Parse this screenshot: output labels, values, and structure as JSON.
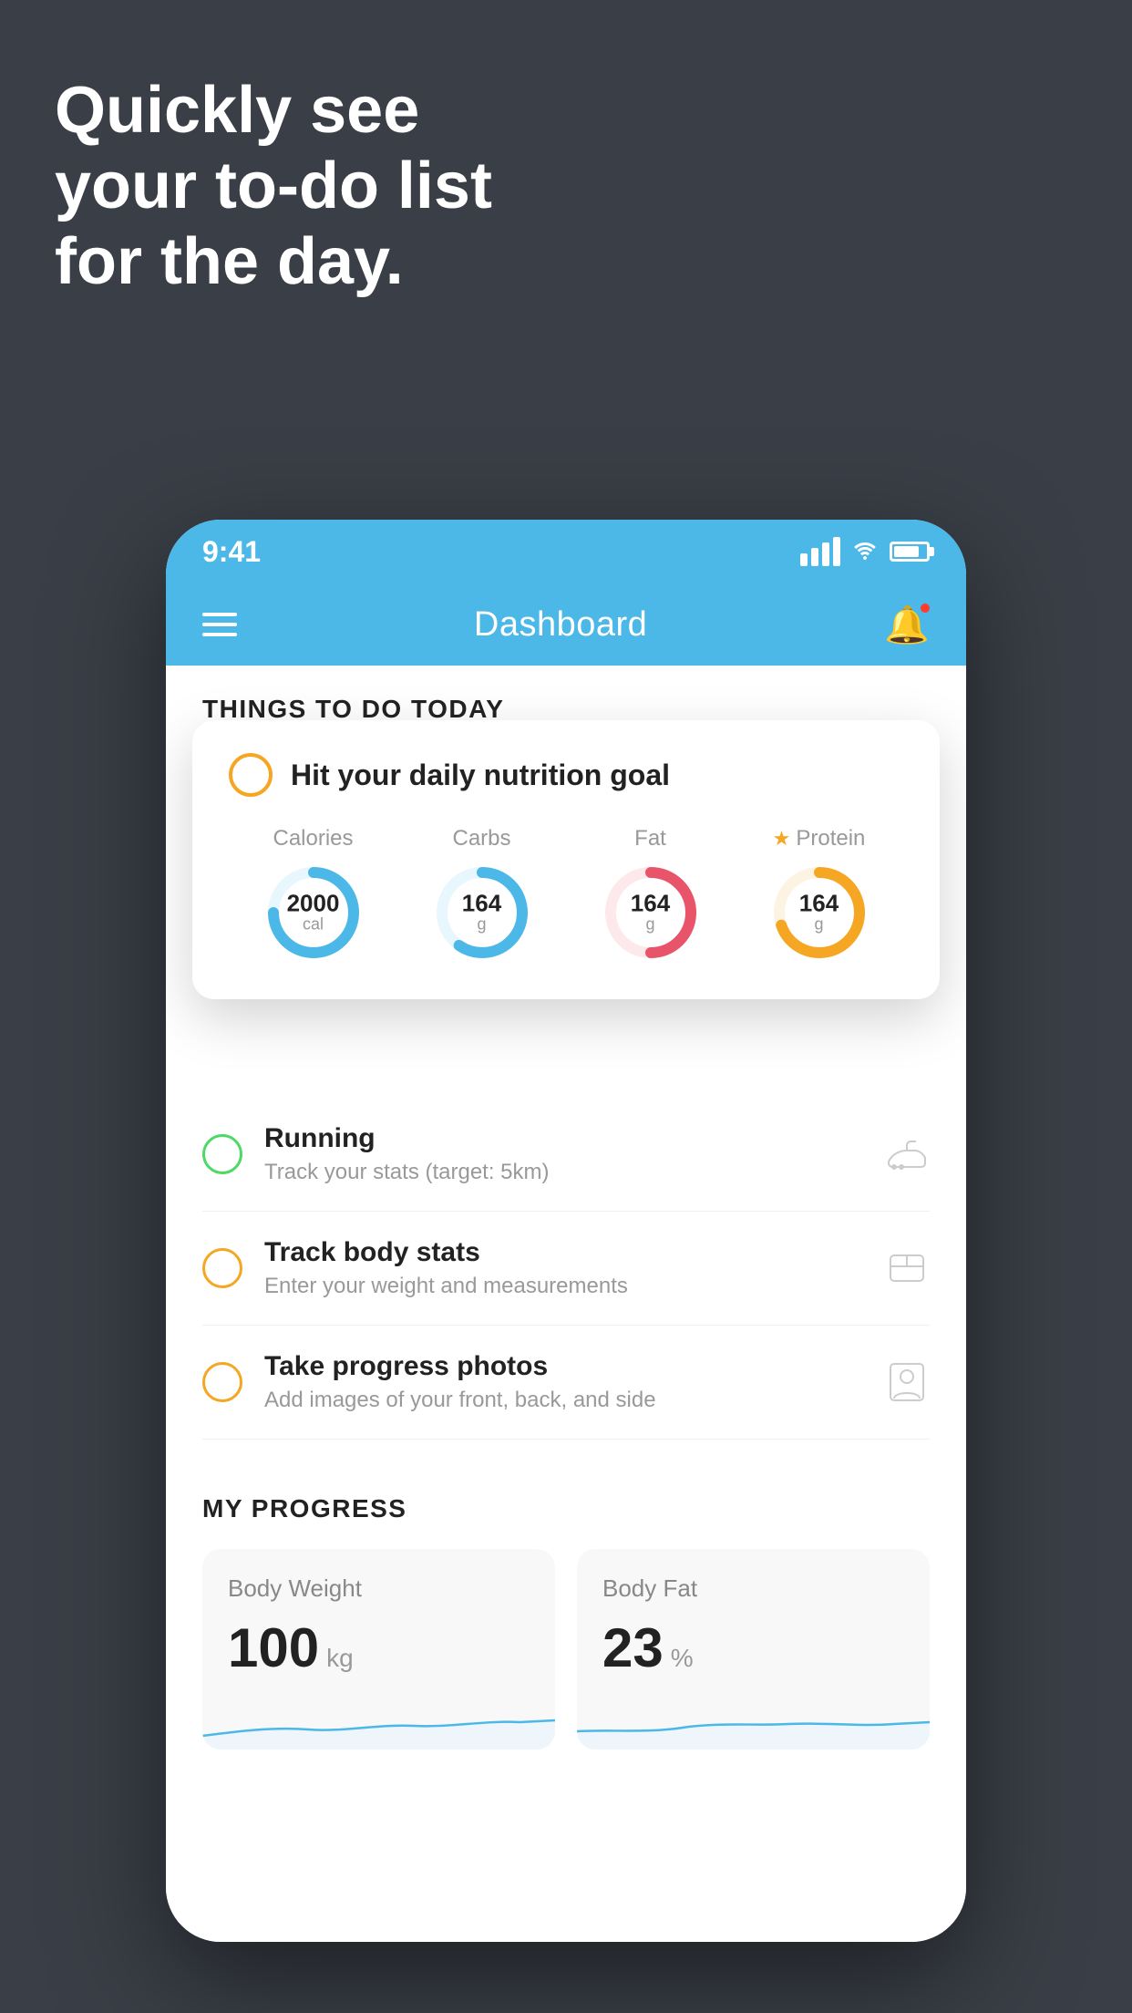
{
  "headline": {
    "line1": "Quickly see",
    "line2": "your to-do list",
    "line3": "for the day."
  },
  "phone": {
    "status_bar": {
      "time": "9:41"
    },
    "header": {
      "title": "Dashboard"
    },
    "things_today": {
      "heading": "THINGS TO DO TODAY"
    },
    "floating_card": {
      "title": "Hit your daily nutrition goal",
      "nutrition": [
        {
          "label": "Calories",
          "value": "2000",
          "unit": "cal",
          "color": "#4bb8e8",
          "track": 75
        },
        {
          "label": "Carbs",
          "value": "164",
          "unit": "g",
          "color": "#4bb8e8",
          "track": 60
        },
        {
          "label": "Fat",
          "value": "164",
          "unit": "g",
          "color": "#e85469",
          "track": 50
        },
        {
          "label": "Protein",
          "value": "164",
          "unit": "g",
          "color": "#f5a623",
          "track": 70,
          "star": true
        }
      ]
    },
    "todo_items": [
      {
        "title": "Running",
        "subtitle": "Track your stats (target: 5km)",
        "circle": "green",
        "icon": "shoe"
      },
      {
        "title": "Track body stats",
        "subtitle": "Enter your weight and measurements",
        "circle": "yellow",
        "icon": "scale"
      },
      {
        "title": "Take progress photos",
        "subtitle": "Add images of your front, back, and side",
        "circle": "yellow",
        "icon": "person"
      }
    ],
    "progress": {
      "heading": "MY PROGRESS",
      "cards": [
        {
          "title": "Body Weight",
          "value": "100",
          "unit": "kg"
        },
        {
          "title": "Body Fat",
          "value": "23",
          "unit": "%"
        }
      ]
    }
  }
}
